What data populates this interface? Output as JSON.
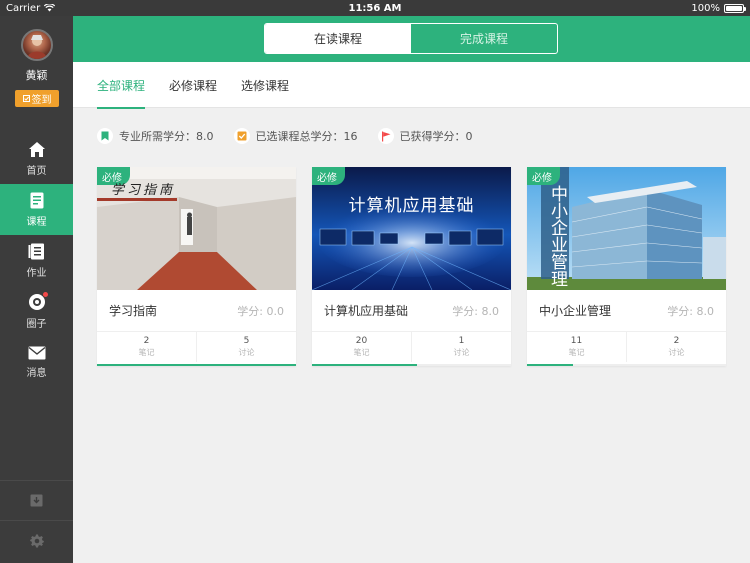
{
  "status_bar": {
    "carrier": "Carrier",
    "time": "11:56 AM",
    "battery": "100%"
  },
  "sidebar": {
    "user_name": "黄颖",
    "checkin_label": "签到",
    "items": [
      {
        "label": "首页",
        "icon": "home-icon",
        "active": false
      },
      {
        "label": "课程",
        "icon": "course-book-icon",
        "active": true
      },
      {
        "label": "作业",
        "icon": "homework-icon",
        "active": false
      },
      {
        "label": "圈子",
        "icon": "circle-icon",
        "active": false
      },
      {
        "label": "消息",
        "icon": "mail-icon",
        "active": false
      }
    ],
    "bottom_icons": [
      "download-box-icon",
      "gear-icon"
    ]
  },
  "header": {
    "segments": [
      "在读课程",
      "完成课程"
    ],
    "active_segment": 0
  },
  "tabs": [
    "全部课程",
    "必修课程",
    "选修课程"
  ],
  "credits": [
    {
      "label": "专业所需学分：8.0",
      "icon": "bookmark-icon",
      "color": "#2db27d"
    },
    {
      "label": "已选课程总学分：16",
      "icon": "checkbox-icon",
      "color": "#f0a02c"
    },
    {
      "label": "已获得学分：0",
      "icon": "flag-icon",
      "color": "#f34a4a"
    }
  ],
  "courses": [
    {
      "badge": "必修",
      "name": "学习指南",
      "credit": "学分: 0.0",
      "image_text": "学习指南",
      "notes": "2",
      "notes_label": "笔记",
      "discussions": "5",
      "discussions_label": "讨论",
      "progress": 1.0
    },
    {
      "badge": "必修",
      "name": "计算机应用基础",
      "credit": "学分: 8.0",
      "image_text": "计算机应用基础",
      "notes": "20",
      "notes_label": "笔记",
      "discussions": "1",
      "discussions_label": "讨论",
      "progress": 0.53
    },
    {
      "badge": "必修",
      "name": "中小企业管理",
      "credit": "学分: 8.0",
      "image_text": "中小企业管理",
      "notes": "11",
      "notes_label": "笔记",
      "discussions": "2",
      "discussions_label": "讨论",
      "progress": 0.23
    }
  ],
  "colors": {
    "accent": "#2db27d",
    "sidebar": "#3c3c3c",
    "badge_orange": "#f0a02c"
  }
}
